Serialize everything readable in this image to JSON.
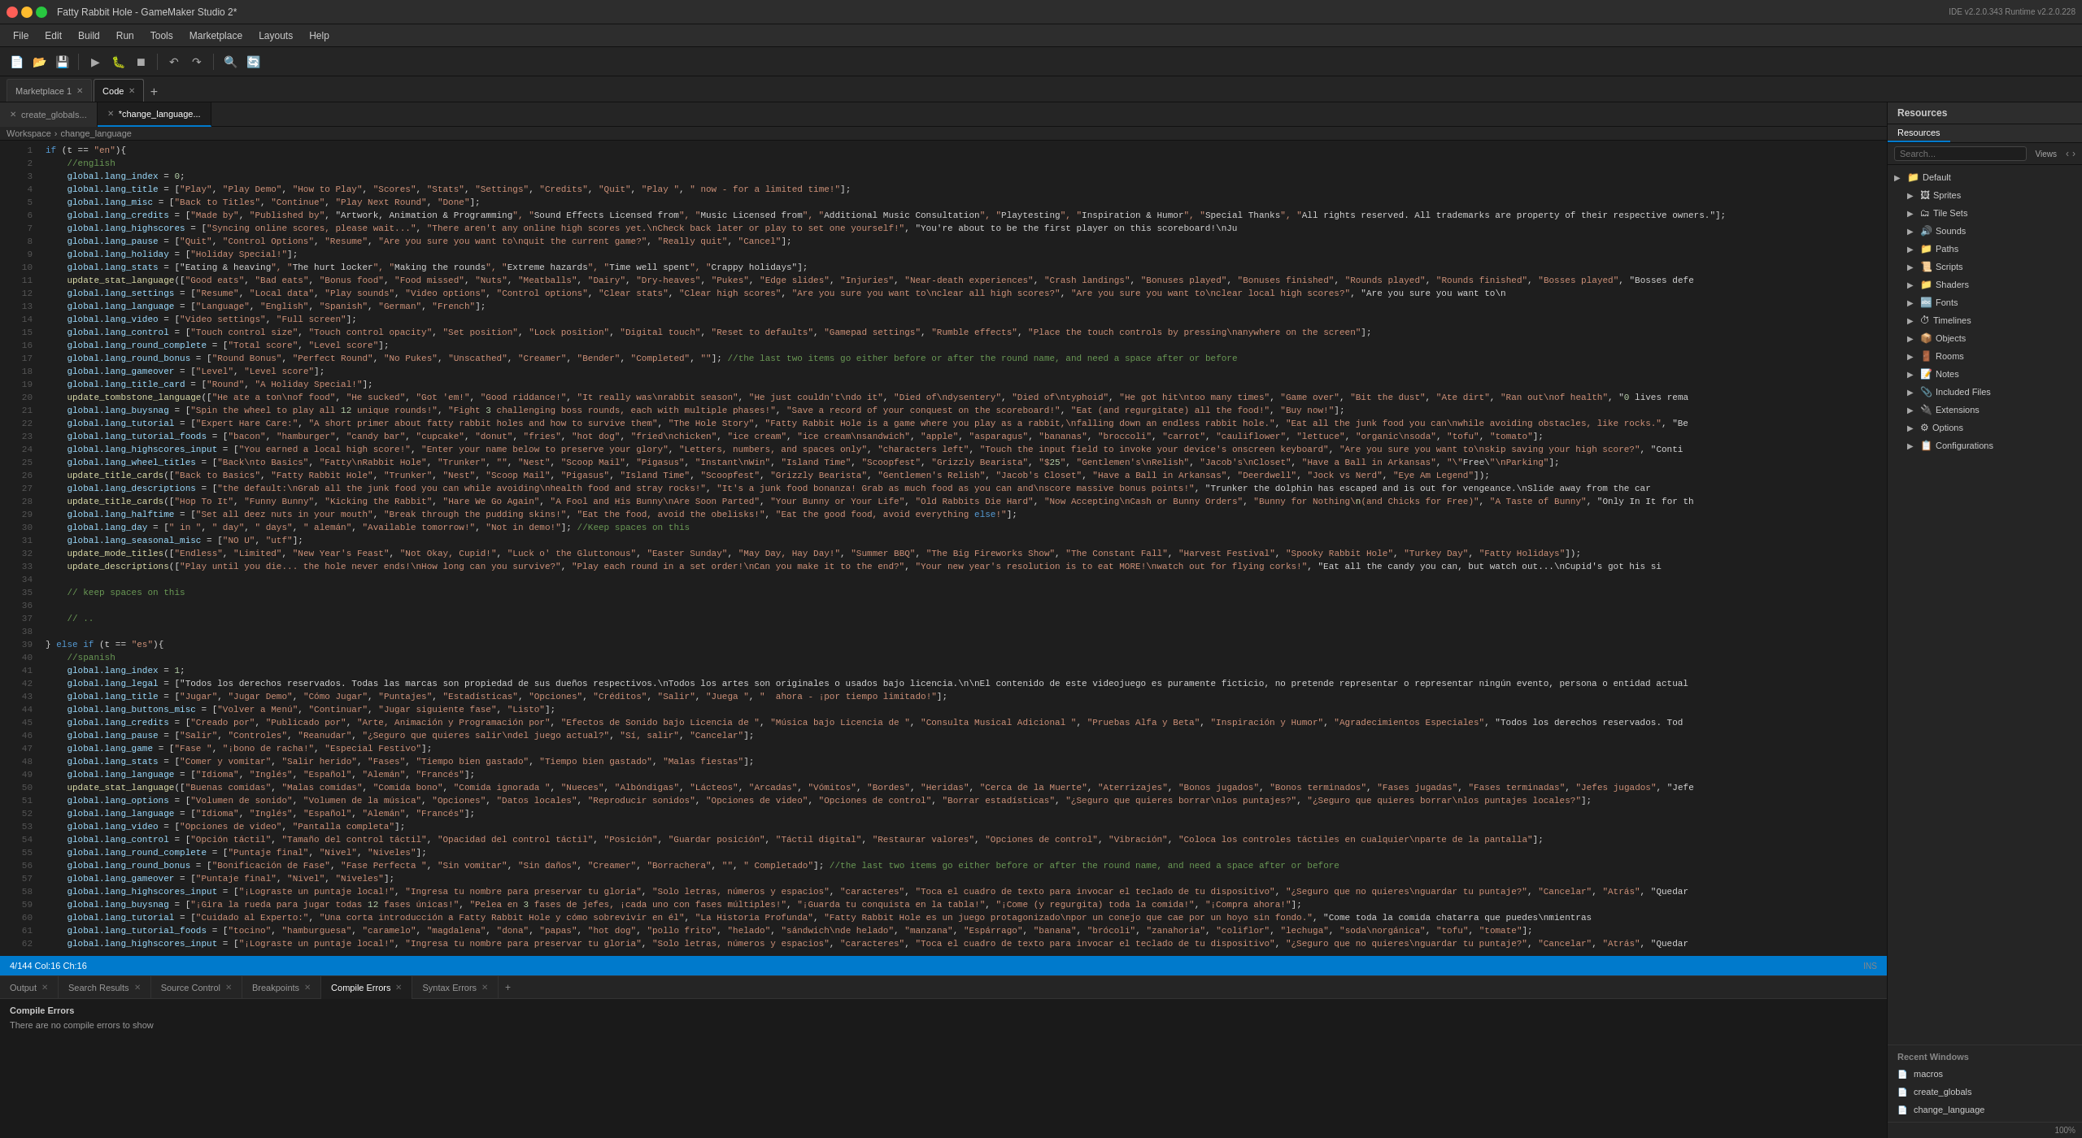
{
  "titleBar": {
    "title": "Fatty Rabbit Hole - GameMaker Studio 2*",
    "ideVersion": "IDE v2.2.0.343 Runtime v2.2.0.228"
  },
  "menuBar": {
    "items": [
      "File",
      "Edit",
      "Build",
      "Run",
      "Tools",
      "Marketplace",
      "Layouts",
      "Help"
    ]
  },
  "toolbar": {
    "groups": [
      [
        "new",
        "open",
        "save"
      ],
      [
        "play",
        "debug",
        "stop"
      ],
      [
        "undo",
        "redo"
      ],
      [
        "search",
        "replace"
      ]
    ]
  },
  "topTabs": {
    "tabs": [
      {
        "label": "Marketplace 1",
        "active": false,
        "closeable": true
      },
      {
        "label": "Code",
        "active": true,
        "closeable": true
      }
    ]
  },
  "fileTabs": {
    "tabs": [
      {
        "label": "create_globals...",
        "active": false,
        "closeable": true
      },
      {
        "label": "*change_language...",
        "active": true,
        "closeable": true
      }
    ]
  },
  "editor": {
    "cursor": "4/144 Col:16 Ch:16",
    "mode": "INS",
    "lines": [
      {
        "num": 1,
        "content": "if (t == \"en\"){"
      },
      {
        "num": 2,
        "content": "    //english"
      },
      {
        "num": 3,
        "content": "    global.lang_index = 0;"
      },
      {
        "num": 4,
        "content": "    global.lang_title = [\"Play\", \"Play Demo\", \"How to Play\", \"Scores\", \"Stats\", \"Settings\", \"Credits\", \"Quit\", \"Play \", \" now - for a limited time!\"];"
      },
      {
        "num": 5,
        "content": "    global.lang_misc = [\"Back to Titles\", \"Continue\", \"Play Next Round\", \"Done\"];"
      },
      {
        "num": 6,
        "content": "    global.lang_credits = [\"Made by\", \"Published by\", \"Artwork, Animation & Programming\", \"Sound Effects Licensed from\", \"Music Licensed from\", \"Additional Music Consultation\", \"Playtesting\", \"Inspiration & Humor\", \"Special Thanks\", \"All rights reserved. All trademarks are property of their respective owners.\"];"
      },
      {
        "num": 7,
        "content": "    global.lang_highscores = [\"Syncing online scores, please wait...\", \"There aren't any online high scores yet.\\nCheck back later or play to set one yourself!\", \"You're about to be the first player on this scoreboard!\\nJu"
      },
      {
        "num": 8,
        "content": "    global.lang_pause = [\"Quit\", \"Control Options\", \"Resume\", \"Are you sure you want to\\nquit the current game?\", \"Really quit\", \"Cancel\"];"
      },
      {
        "num": 9,
        "content": "    global.lang_holiday = [\"Holiday Special!\"];"
      },
      {
        "num": 10,
        "content": "    global.lang_stats = [\"Eating & heaving\", \"The hurt locker\", \"Making the rounds\", \"Extreme hazards\", \"Time well spent\", \"Crappy holidays\"];"
      },
      {
        "num": 11,
        "content": "    update_stat_language([\"Good eats\", \"Bad eats\", \"Bonus food\", \"Food missed\", \"Nuts\", \"Meatballs\", \"Dairy\", \"Dry-heaves\", \"Pukes\", \"Edge slides\", \"Injuries\", \"Near-death experiences\", \"Crash landings\", \"Bonuses played\", \"Bonuses finished\", \"Rounds played\", \"Rounds finished\", \"Bosses played\", \"Bosses defe"
      },
      {
        "num": 12,
        "content": "    global.lang_settings = [\"Resume\", \"Local data\", \"Play sounds\", \"Video options\", \"Control options\", \"Clear stats\", \"Clear high scores\", \"Are you sure you want to\\nclear all high scores?\", \"Are you sure you want to\\nclear local high scores?\", \"Are you sure you want to\\n"
      },
      {
        "num": 13,
        "content": "    global.lang_language = [\"Language\", \"English\", \"Spanish\", \"German\", \"French\"];"
      },
      {
        "num": 14,
        "content": "    global.lang_video = [\"Video settings\", \"Full screen\"];"
      },
      {
        "num": 15,
        "content": "    global.lang_control = [\"Touch control size\", \"Touch control opacity\", \"Set position\", \"Lock position\", \"Digital touch\", \"Reset to defaults\", \"Gamepad settings\", \"Rumble effects\", \"Place the touch controls by pressing\\nanywhere on the screen\"];"
      },
      {
        "num": 16,
        "content": "    global.lang_round_complete = [\"Total score\", \"Level score\"];"
      },
      {
        "num": 17,
        "content": "    global.lang_round_bonus = [\"Round Bonus\", \"Perfect Round\", \"No Pukes\", \"Unscathed\", \"Creamer\", \"Bender\", \"Completed\", \"\"]; //the last two items go either before or after the round name, and need a space after or before"
      },
      {
        "num": 18,
        "content": "    global.lang_gameover = [\"Level\", \"Level score\"];"
      },
      {
        "num": 19,
        "content": "    global.lang_title_card = [\"Round\", \"A Holiday Special!\"];"
      },
      {
        "num": 20,
        "content": "    update_tombstone_language([\"He ate a ton\\nof food\", \"He sucked\", \"Got 'em!\", \"Good riddance!\", \"It really was\\nrabbit season\", \"He just couldn't\\ndo it\", \"Died of\\ndysentery\", \"Died of\\ntyphoid\", \"He got hit\\ntoo many times\", \"Game over\", \"Bit the dust\", \"Ate dirt\", \"Ran out\\nof health\", \"0 lives rema"
      },
      {
        "num": 21,
        "content": "    global.lang_buysnag = [\"Spin the wheel to play all 12 unique rounds!\", \"Fight 3 challenging boss rounds, each with multiple phases!\", \"Save a record of your conquest on the scoreboard!\", \"Eat (and regurgitate) all the food!\", \"Buy now!\"];"
      },
      {
        "num": 22,
        "content": "    global.lang_tutorial = [\"Expert Hare Care:\", \"A short primer about fatty rabbit holes and how to survive them\", \"The Hole Story\", \"Fatty Rabbit Hole is a game where you play as a rabbit,\\nfalling down an endless rabbit hole.\", \"Eat all the junk food you can\\nwhile avoiding obstacles, like rocks.\", \"Be"
      },
      {
        "num": 23,
        "content": "    global.lang_tutorial_foods = [\"bacon\", \"hamburger\", \"candy bar\", \"cupcake\", \"donut\", \"fries\", \"hot dog\", \"fried\\nchicken\", \"ice cream\", \"ice cream\\nsandwich\", \"apple\", \"asparagus\", \"bananas\", \"broccoli\", \"carrot\", \"cauliflower\", \"lettuce\", \"organic\\nsoda\", \"tofu\", \"tomato\"];"
      },
      {
        "num": 24,
        "content": "    global.lang_highscores_input = [\"You earned a local high score!\", \"Enter your name below to preserve your glory\", \"Letters, numbers, and spaces only\", \"characters left\", \"Touch the input field to invoke your device's onscreen keyboard\", \"Are you sure you want to\\nskip saving your high score?\", \"Conti"
      },
      {
        "num": 25,
        "content": "    global.lang_wheel_titles = [\"Back\\nto Basics\", \"Fatty\\nRabbit Hole\", \"Trunker\", \"\", \"Nest\", \"Scoop Mail\", \"Pigasus\", \"Instant\\nWin\", \"Island Time\", \"Scoopfest\", \"Grizzly Bearista\", \"$25\", \"Gentlemen's\\nRelish\", \"Jacob's\\nCloset\", \"Have a Ball in Arkansas\", \"\\\"Free\\\"\\nParking\"];"
      },
      {
        "num": 26,
        "content": "    update_title_cards([\"Back to Basics\", \"Fatty Rabbit Hole\", \"Trunker\", \"Nest\", \"Scoop Mail\", \"Pigasus\", \"Island Time\", \"Scoopfest\", \"Grizzly Bearista\", \"Gentlemen's Relish\", \"Jacob's Closet\", \"Have a Ball in Arkansas\", \"Deerdwell\", \"Jock vs Nerd\", \"Eye Am Legend\"]);"
      },
      {
        "num": 27,
        "content": "    global.lang_descriptions = [\"the default:\\nGrab all the junk food you can while avoiding\\nhealth food and stray rocks!\", \"It's a junk food bonanza! Grab as much food as you can and\\nscore massive bonus points!\", \"Trunker the dolphin has escaped and is out for vengeance.\\nSlide away from the car"
      },
      {
        "num": 28,
        "content": "    update_title_cards([\"Hop To It\", \"Funny Bunny\", \"Kicking the Rabbit\", \"Hare We Go Again\", \"A Fool and His Bunny\\nAre Soon Parted\", \"Your Bunny or Your Life\", \"Old Rabbits Die Hard\", \"Now Accepting\\nCash or Bunny Orders\", \"Bunny for Nothing\\n(and Chicks for Free)\", \"A Taste of Bunny\", \"Only In It for th"
      },
      {
        "num": 29,
        "content": "    global.lang_halftime = [\"Set all deez nuts in your mouth\", \"Break through the pudding skins!\", \"Eat the food, avoid the obelisks!\", \"Eat the good food, avoid everything else!\"];"
      },
      {
        "num": 30,
        "content": "    global.lang_day = [\" in \", \" day\", \" days\", \" alemán\", \"Available tomorrow!\", \"Not in demo!\"]; //Keep spaces on this"
      },
      {
        "num": 31,
        "content": "    global.lang_seasonal_misc = [\"NO U\", \"utf\"];"
      },
      {
        "num": 32,
        "content": "    update_mode_titles([\"Endless\", \"Limited\", \"New Year's Feast\", \"Not Okay, Cupid!\", \"Luck o' the Gluttonous\", \"Easter Sunday\", \"May Day, Hay Day!\", \"Summer BBQ\", \"The Big Fireworks Show\", \"The Constant Fall\", \"Harvest Festival\", \"Spooky Rabbit Hole\", \"Turkey Day\", \"Fatty Holidays\"]);"
      },
      {
        "num": 33,
        "content": "    update_descriptions([\"Play until you die... the hole never ends!\\nHow long can you survive?\", \"Play each round in a set order!\\nCan you make it to the end?\", \"Your new year's resolution is to eat MORE!\\nwatch out for flying corks!\", \"Eat all the candy you can, but watch out...\\nCupid's got his si"
      },
      {
        "num": 34,
        "content": ""
      },
      {
        "num": 35,
        "content": "    // keep spaces on this"
      },
      {
        "num": 36,
        "content": ""
      },
      {
        "num": 37,
        "content": "    // .."
      },
      {
        "num": 38,
        "content": ""
      },
      {
        "num": 39,
        "content": "} else if (t == \"es\"){"
      },
      {
        "num": 40,
        "content": "    //spanish"
      },
      {
        "num": 41,
        "content": "    global.lang_index = 1;"
      },
      {
        "num": 42,
        "content": "    global.lang_legal = [\"Todos los derechos reservados. Todas las marcas son propiedad de sus dueños respectivos.\\nTodos los artes son originales o usados bajo licencia.\\n\\nEl contenido de este videojuego es puramente ficticio, no pretende representar o representar ningún evento, persona o entidad actual"
      },
      {
        "num": 43,
        "content": "    global.lang_title = [\"Jugar\", \"Jugar Demo\", \"Cómo Jugar\", \"Puntajes\", \"Estadísticas\", \"Opciones\", \"Créditos\", \"Salir\", \"Juega \", \"  ahora - ¡por tiempo limitado!\"];"
      },
      {
        "num": 44,
        "content": "    global.lang_buttons_misc = [\"Volver a Menú\", \"Continuar\", \"Jugar siguiente fase\", \"Listo\"];"
      },
      {
        "num": 45,
        "content": "    global.lang_credits = [\"Creado por\", \"Publicado por\", \"Arte, Animación y Programación por\", \"Efectos de Sonido bajo Licencia de \", \"Música bajo Licencia de \", \"Consulta Musical Adicional \", \"Pruebas Alfa y Beta\", \"Inspiración y Humor\", \"Agradecimientos Especiales\", \"Todos los derechos reservados. Tod"
      },
      {
        "num": 46,
        "content": "    global.lang_pause = [\"Salir\", \"Controles\", \"Reanudar\", \"¿Seguro que quieres salir\\ndel juego actual?\", \"Sí, salir\", \"Cancelar\"];"
      },
      {
        "num": 47,
        "content": "    global.lang_game = [\"Fase \", \"¡bono de racha!\", \"Especial Festivo\"];"
      },
      {
        "num": 48,
        "content": "    global.lang_stats = [\"Comer y vomitar\", \"Salir herido\", \"Fases\", \"Tiempo bien gastado\", \"Tiempo bien gastado\", \"Malas fiestas\"];"
      },
      {
        "num": 49,
        "content": "    global.lang_language = [\"Idioma\", \"Inglés\", \"Español\", \"Alemán\", \"Francés\"];"
      },
      {
        "num": 50,
        "content": "    update_stat_language([\"Buenas comidas\", \"Malas comidas\", \"Comida bono\", \"Comida ignorada \", \"Nueces\", \"Albóndigas\", \"Lácteos\", \"Arcadas\", \"Vómitos\", \"Bordes\", \"Heridas\", \"Cerca de la Muerte\", \"Aterrizajes\", \"Bonos jugados\", \"Bonos terminados\", \"Fases jugadas\", \"Fases terminadas\", \"Jefes jugados\", \"Jefe"
      },
      {
        "num": 51,
        "content": "    global.lang_options = [\"Volumen de sonido\", \"Volumen de la música\", \"Opciones\", \"Datos locales\", \"Reproducir sonidos\", \"Opciones de video\", \"Opciones de control\", \"Borrar estadísticas\", \"¿Seguro que quieres borrar\\nlos puntajes?\", \"¿Seguro que quieres borrar\\nlos puntajes locales?\"];"
      },
      {
        "num": 52,
        "content": "    global.lang_language = [\"Idioma\", \"Inglés\", \"Español\", \"Alemán\", \"Francés\"];"
      },
      {
        "num": 53,
        "content": "    global.lang_video = [\"Opciones de video\", \"Pantalla completa\"];"
      },
      {
        "num": 54,
        "content": "    global.lang_control = [\"Opción táctil\", \"Tamaño del control táctil\", \"Opacidad del control táctil\", \"Posición\", \"Guardar posición\", \"Táctil digital\", \"Restaurar valores\", \"Opciones de control\", \"Vibración\", \"Coloca los controles táctiles en cualquier\\nparte de la pantalla\"];"
      },
      {
        "num": 55,
        "content": "    global.lang_round_complete = [\"Puntaje final\", \"Nivel\", \"Niveles\"];"
      },
      {
        "num": 56,
        "content": "    global.lang_round_bonus = [\"Bonificación de Fase\", \"Fase Perfecta \", \"Sin vomitar\", \"Sin daños\", \"Creamer\", \"Borrachera\", \"\", \" Completado\"]; //the last two items go either before or after the round name, and need a space after or before"
      },
      {
        "num": 57,
        "content": "    global.lang_gameover = [\"Puntaje final\", \"Nivel\", \"Niveles\"];"
      },
      {
        "num": 58,
        "content": "    global.lang_highscores_input = [\"¡Lograste un puntaje local!\", \"Ingresa tu nombre para preservar tu gloria\", \"Solo letras, números y espacios\", \"caracteres\", \"Toca el cuadro de texto para invocar el teclado de tu dispositivo\", \"¿Seguro que no quieres\\nguardar tu puntaje?\", \"Cancelar\", \"Atrás\", \"Quedar"
      },
      {
        "num": 59,
        "content": "    global.lang_buysnag = [\"¡Gira la rueda para jugar todas 12 fases únicas!\", \"Pelea en 3 fases de jefes, ¡cada uno con fases múltiples!\", \"¡Guarda tu conquista en la tabla!\", \"¡Come (y regurgita) toda la comida!\", \"¡Compra ahora!\"];"
      },
      {
        "num": 60,
        "content": "    global.lang_tutorial = [\"Cuidado al Experto:\", \"Una corta introducción a Fatty Rabbit Hole y cómo sobrevivir en él\", \"La Historia Profunda\", \"Fatty Rabbit Hole es un juego protagonizado\\npor un conejo que cae por un hoyo sin fondo.\", \"Come toda la comida chatarra que puedes\\nmientras"
      },
      {
        "num": 61,
        "content": "    global.lang_tutorial_foods = [\"tocino\", \"hamburguesa\", \"caramelo\", \"magdalena\", \"dona\", \"papas\", \"hot dog\", \"pollo frito\", \"helado\", \"sándwich\\nde helado\", \"manzana\", \"Espárrago\", \"banana\", \"brócoli\", \"zanahoria\", \"coliflor\", \"lechuga\", \"soda\\norgánica\", \"tofu\", \"tomate\"];"
      },
      {
        "num": 62,
        "content": "    global.lang_highscores_input = [\"¡Lograste un puntaje local!\", \"Ingresa tu nombre para preservar tu gloria\", \"Solo letras, números y espacios\", \"caracteres\", \"Toca el cuadro de texto para invocar el teclado de tu dispositivo\", \"¿Seguro que no quieres\\nguardar tu puntaje?\", \"Cancelar\", \"Atrás\", \"Quedar"
      }
    ]
  },
  "bottomPanel": {
    "tabs": [
      {
        "label": "Output",
        "active": false,
        "closeable": true
      },
      {
        "label": "Search Results",
        "active": false,
        "closeable": true
      },
      {
        "label": "Source Control",
        "active": false,
        "closeable": true
      },
      {
        "label": "Breakpoints",
        "active": false,
        "closeable": true
      },
      {
        "label": "Compile Errors",
        "active": true,
        "closeable": true
      },
      {
        "label": "Syntax Errors",
        "active": false,
        "closeable": true
      }
    ],
    "activeContent": {
      "title": "Compile Errors",
      "message": "There are no compile errors to show"
    }
  },
  "rightPanel": {
    "header": "Resources",
    "search": {
      "placeholder": "Search...",
      "viewLabel": "Views"
    },
    "tabs": [
      "Resources"
    ],
    "tree": {
      "items": [
        {
          "label": "Default",
          "type": "folder",
          "expanded": false,
          "indent": 0
        },
        {
          "label": "Sprites",
          "type": "folder",
          "expanded": false,
          "indent": 1
        },
        {
          "label": "Tile Sets",
          "type": "folder",
          "expanded": false,
          "indent": 1
        },
        {
          "label": "Sounds",
          "type": "folder",
          "expanded": false,
          "indent": 1
        },
        {
          "label": "Paths",
          "type": "folder",
          "expanded": false,
          "indent": 1
        },
        {
          "label": "Scripts",
          "type": "folder",
          "expanded": false,
          "indent": 1
        },
        {
          "label": "Shaders",
          "type": "folder",
          "expanded": false,
          "indent": 1
        },
        {
          "label": "Fonts",
          "type": "folder",
          "expanded": false,
          "indent": 1
        },
        {
          "label": "Timelines",
          "type": "folder",
          "expanded": false,
          "indent": 1
        },
        {
          "label": "Objects",
          "type": "folder",
          "expanded": false,
          "indent": 1
        },
        {
          "label": "Rooms",
          "type": "folder",
          "expanded": false,
          "indent": 1
        },
        {
          "label": "Notes",
          "type": "folder",
          "expanded": false,
          "indent": 1
        },
        {
          "label": "Included Files",
          "type": "folder",
          "expanded": false,
          "indent": 1
        },
        {
          "label": "Extensions",
          "type": "folder",
          "expanded": false,
          "indent": 1
        },
        {
          "label": "Options",
          "type": "folder",
          "expanded": false,
          "indent": 1
        },
        {
          "label": "Configurations",
          "type": "folder",
          "expanded": false,
          "indent": 1
        }
      ]
    },
    "recentWindows": {
      "title": "Recent Windows",
      "items": [
        {
          "label": "macros",
          "icon": "📄"
        },
        {
          "label": "create_globals",
          "icon": "📄"
        },
        {
          "label": "change_language",
          "icon": "📄"
        }
      ]
    },
    "zoom": "100%"
  },
  "statusBar": {
    "cursorInfo": "4/144 Col:16 Ch:16",
    "mode": "INS"
  },
  "workspace": {
    "label": "Workspace"
  },
  "controlOptions": {
    "label": "Control Options"
  },
  "searchLabel": "Search",
  "includedFiles": "Included Files",
  "completed": "Completed",
  "searchResults": "Search Results",
  "sourceControl": "Source Control",
  "recentWindowsLabel": "Recent Windows"
}
